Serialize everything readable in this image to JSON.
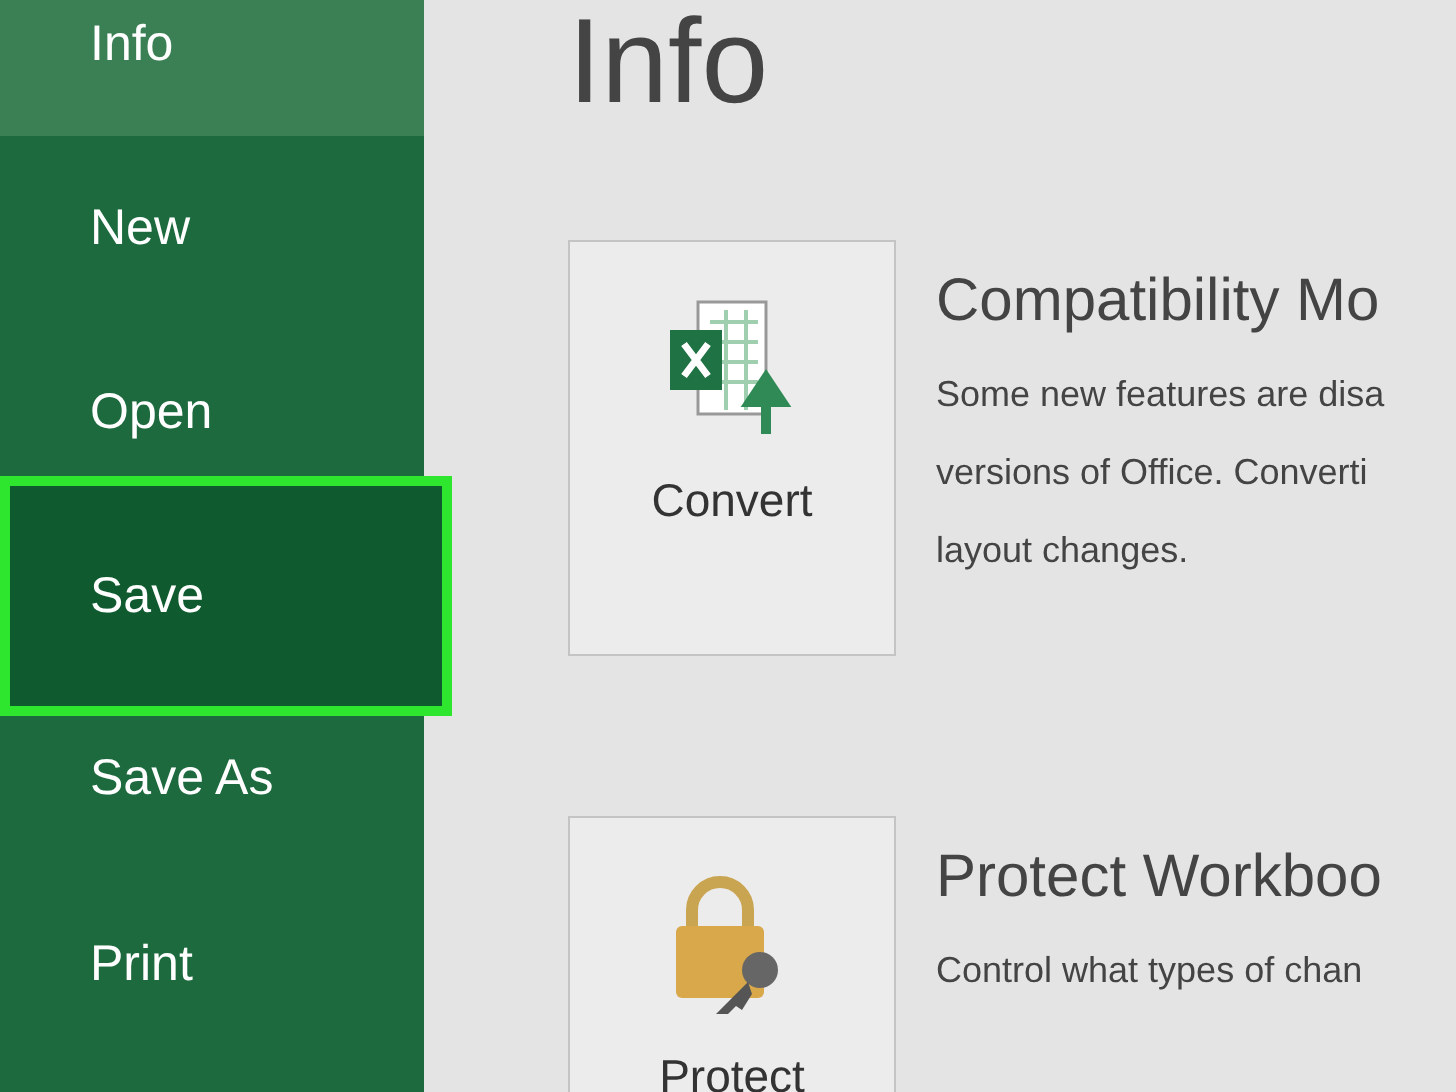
{
  "sidebar": {
    "items": [
      {
        "label": "Info",
        "selected": true,
        "highlighted": false
      },
      {
        "label": "New",
        "selected": false,
        "highlighted": false
      },
      {
        "label": "Open",
        "selected": false,
        "highlighted": false
      },
      {
        "label": "Save",
        "selected": false,
        "highlighted": true
      },
      {
        "label": "Save As",
        "selected": false,
        "highlighted": false
      },
      {
        "label": "Print",
        "selected": false,
        "highlighted": false
      }
    ]
  },
  "page": {
    "title": "Info"
  },
  "sections": [
    {
      "kind": "convert",
      "button": "Convert",
      "title": "Compatibility Mo",
      "description": "Some new features are disa\nversions of Office. Converti\nlayout changes."
    },
    {
      "kind": "protect",
      "button": "Protect",
      "title": "Protect Workboo",
      "description": "Control what types of chan"
    }
  ]
}
